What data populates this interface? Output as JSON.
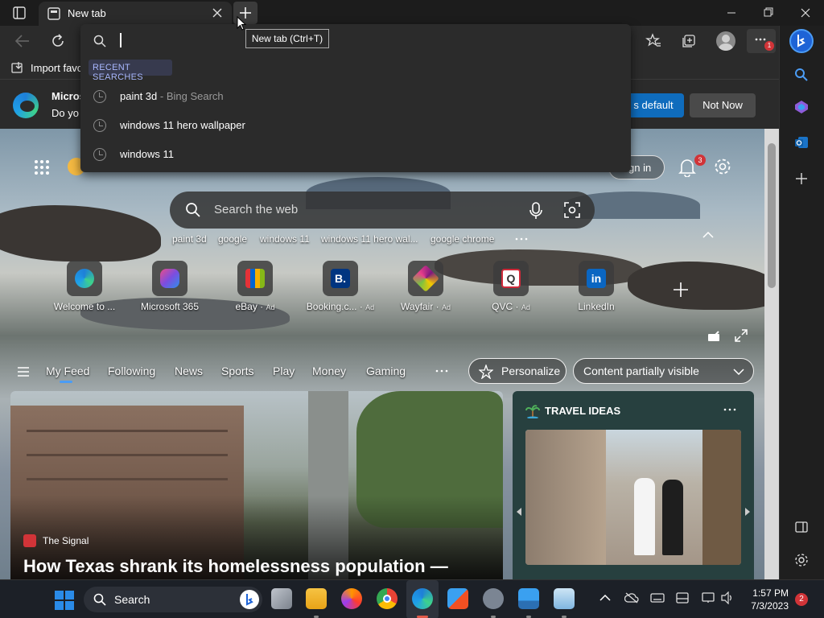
{
  "browser": {
    "tab_title": "New tab",
    "new_tab_tooltip": "New tab (Ctrl+T)",
    "profile_badge": "1"
  },
  "address_dropdown": {
    "section_label": "RECENT SEARCHES",
    "items": [
      {
        "text": "paint 3d",
        "suffix": "- Bing Search"
      },
      {
        "text": "windows 11 hero wallpaper",
        "suffix": ""
      },
      {
        "text": "windows 11",
        "suffix": ""
      }
    ]
  },
  "favorites_bar": {
    "import_label": "Import favo"
  },
  "infobar": {
    "title": "Micros",
    "body": "Do yo",
    "set_default_label": "s default",
    "not_now_label": "Not Now"
  },
  "newtab": {
    "sign_in_label": "gn in",
    "notification_count": "3",
    "search_placeholder": "Search the web",
    "suggestions": [
      "paint 3d",
      "google",
      "windows 11",
      "windows 11 hero wal...",
      "google chrome"
    ],
    "quick_links": [
      {
        "label": "Welcome to ...",
        "ad": ""
      },
      {
        "label": "Microsoft 365",
        "ad": ""
      },
      {
        "label": "eBay",
        "ad": "Ad"
      },
      {
        "label": "Booking.c...",
        "ad": "Ad"
      },
      {
        "label": "Wayfair",
        "ad": "Ad"
      },
      {
        "label": "QVC",
        "ad": "Ad"
      },
      {
        "label": "LinkedIn",
        "ad": ""
      }
    ],
    "feed_tabs": [
      "My Feed",
      "Following",
      "News",
      "Sports",
      "Play",
      "Money",
      "Gaming"
    ],
    "personalize_label": "Personalize",
    "content_visibility_label": "Content partially visible",
    "main_card": {
      "source": "The Signal",
      "headline": "How Texas shrank its homelessness population —"
    },
    "travel_card": {
      "title": "TRAVEL IDEAS"
    }
  },
  "taskbar": {
    "search_label": "Search",
    "time": "1:57 PM",
    "date": "7/3/2023",
    "notification_count": "2"
  },
  "colors": {
    "accent": "#0f6cbd",
    "bing_blue": "#1e63d6",
    "badge_red": "#d13438"
  }
}
